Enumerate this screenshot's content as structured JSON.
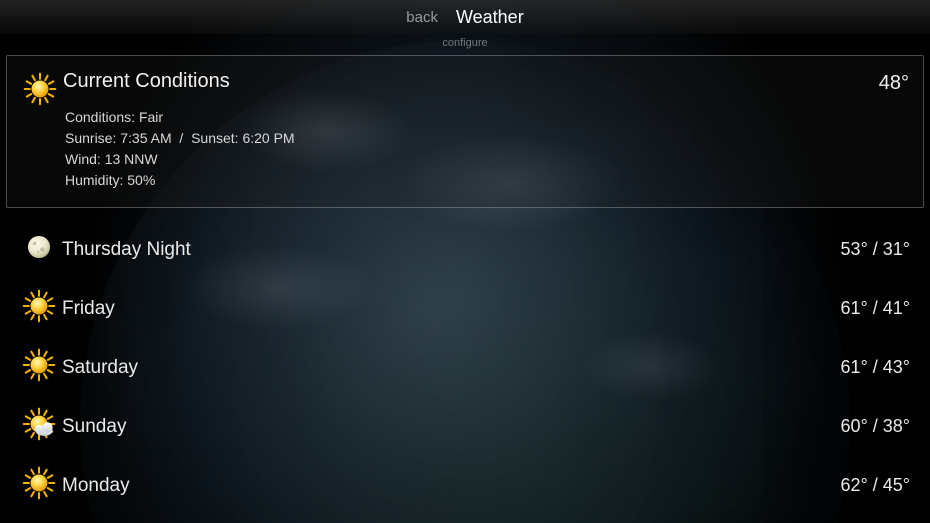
{
  "header": {
    "back_label": "back",
    "title": "Weather",
    "configure_label": "configure"
  },
  "current": {
    "title": "Current Conditions",
    "temp": "48°",
    "icon": "sun",
    "conditions_label": "Conditions:",
    "conditions_value": "Fair",
    "sunrise_label": "Sunrise:",
    "sunrise_value": "7:35 AM",
    "sun_separator": "/",
    "sunset_label": "Sunset:",
    "sunset_value": "6:20 PM",
    "wind_label": "Wind:",
    "wind_value": "13 NNW",
    "humidity_label": "Humidity:",
    "humidity_value": "50%"
  },
  "forecast": [
    {
      "day": "Thursday Night",
      "icon": "moon",
      "hi": "53°",
      "lo": "31°"
    },
    {
      "day": "Friday",
      "icon": "sun",
      "hi": "61°",
      "lo": "41°"
    },
    {
      "day": "Saturday",
      "icon": "sun",
      "hi": "61°",
      "lo": "43°"
    },
    {
      "day": "Sunday",
      "icon": "partly-cloudy",
      "hi": "60°",
      "lo": "38°"
    },
    {
      "day": "Monday",
      "icon": "sun",
      "hi": "62°",
      "lo": "45°"
    }
  ],
  "temp_separator": " / "
}
